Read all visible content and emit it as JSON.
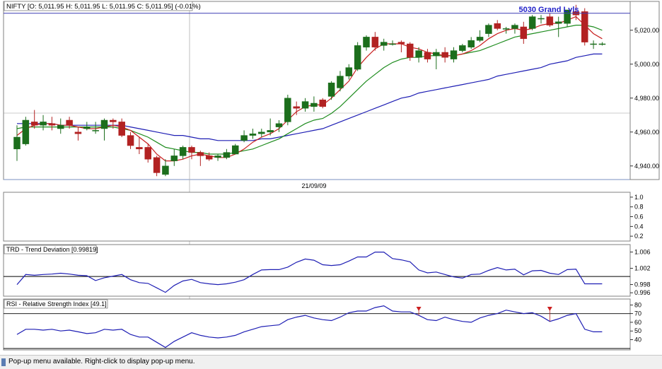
{
  "chart_data": [
    {
      "type": "candlestick",
      "header": "NIFTY [O: 5,011.95  H: 5,011.95  L: 5,011.95  C: 5,011.95] (-0.01%)",
      "annotation": "5030 Grand Lvls",
      "x_date_label": "21/09/09",
      "ylim": [
        4932,
        5037
      ],
      "y_ticks": [
        "5,020.00",
        "5,000.00",
        "4,980.00",
        "4,960.00",
        "4,940.00"
      ],
      "y_tick_values": [
        5020,
        5000,
        4980,
        4960,
        4940
      ],
      "hline": 5030,
      "candles": [
        {
          "o": 4950,
          "h": 4964,
          "l": 4943,
          "c": 4957
        },
        {
          "o": 4953,
          "h": 4969,
          "l": 4952,
          "c": 4967
        },
        {
          "o": 4966,
          "h": 4973,
          "l": 4962,
          "c": 4964
        },
        {
          "o": 4964,
          "h": 4970,
          "l": 4961,
          "c": 4966
        },
        {
          "o": 4965,
          "h": 4969,
          "l": 4961,
          "c": 4964
        },
        {
          "o": 4962,
          "h": 4968,
          "l": 4959,
          "c": 4964
        },
        {
          "o": 4967,
          "h": 4969,
          "l": 4962,
          "c": 4964
        },
        {
          "o": 4960,
          "h": 4963,
          "l": 4955,
          "c": 4959
        },
        {
          "o": 4962,
          "h": 4966,
          "l": 4961,
          "c": 4963
        },
        {
          "o": 4961,
          "h": 4966,
          "l": 4959,
          "c": 4961
        },
        {
          "o": 4962,
          "h": 4968,
          "l": 4955,
          "c": 4967
        },
        {
          "o": 4967,
          "h": 4968,
          "l": 4962,
          "c": 4966
        },
        {
          "o": 4966,
          "h": 4968,
          "l": 4957,
          "c": 4958
        },
        {
          "o": 4958,
          "h": 4960,
          "l": 4950,
          "c": 4952
        },
        {
          "o": 4951,
          "h": 4957,
          "l": 4947,
          "c": 4950
        },
        {
          "o": 4951,
          "h": 4953,
          "l": 4942,
          "c": 4944
        },
        {
          "o": 4945,
          "h": 4946,
          "l": 4934,
          "c": 4936
        },
        {
          "o": 4935,
          "h": 4944,
          "l": 4934,
          "c": 4940
        },
        {
          "o": 4943,
          "h": 4950,
          "l": 4940,
          "c": 4946
        },
        {
          "o": 4946,
          "h": 4952,
          "l": 4944,
          "c": 4951
        },
        {
          "o": 4951,
          "h": 4952,
          "l": 4944,
          "c": 4948
        },
        {
          "o": 4948,
          "h": 4949,
          "l": 4940,
          "c": 4946
        },
        {
          "o": 4946,
          "h": 4948,
          "l": 4943,
          "c": 4944
        },
        {
          "o": 4945,
          "h": 4947,
          "l": 4943,
          "c": 4946
        },
        {
          "o": 4945,
          "h": 4950,
          "l": 4944,
          "c": 4948
        },
        {
          "o": 4947,
          "h": 4953,
          "l": 4947,
          "c": 4952
        },
        {
          "o": 4955,
          "h": 4961,
          "l": 4954,
          "c": 4958
        },
        {
          "o": 4958,
          "h": 4962,
          "l": 4956,
          "c": 4959
        },
        {
          "o": 4959,
          "h": 4962,
          "l": 4957,
          "c": 4960
        },
        {
          "o": 4960,
          "h": 4968,
          "l": 4958,
          "c": 4961
        },
        {
          "o": 4963,
          "h": 4967,
          "l": 4960,
          "c": 4965
        },
        {
          "o": 4966,
          "h": 4982,
          "l": 4964,
          "c": 4980
        },
        {
          "o": 4975,
          "h": 4978,
          "l": 4970,
          "c": 4974
        },
        {
          "o": 4974,
          "h": 4980,
          "l": 4972,
          "c": 4978
        },
        {
          "o": 4975,
          "h": 4981,
          "l": 4972,
          "c": 4977
        },
        {
          "o": 4979,
          "h": 4980,
          "l": 4974,
          "c": 4975
        },
        {
          "o": 4981,
          "h": 4990,
          "l": 4979,
          "c": 4989
        },
        {
          "o": 4986,
          "h": 4996,
          "l": 4984,
          "c": 4993
        },
        {
          "o": 4993,
          "h": 5000,
          "l": 4991,
          "c": 4998
        },
        {
          "o": 4997,
          "h": 5013,
          "l": 4996,
          "c": 5011
        },
        {
          "o": 5010,
          "h": 5017,
          "l": 5008,
          "c": 5016
        },
        {
          "o": 5016,
          "h": 5019,
          "l": 5008,
          "c": 5010
        },
        {
          "o": 5011,
          "h": 5015,
          "l": 5008,
          "c": 5013
        },
        {
          "o": 5012,
          "h": 5014,
          "l": 5011,
          "c": 5012
        },
        {
          "o": 5013,
          "h": 5014,
          "l": 5007,
          "c": 5012
        },
        {
          "o": 5012,
          "h": 5013,
          "l": 5002,
          "c": 5004
        },
        {
          "o": 5004,
          "h": 5010,
          "l": 5001,
          "c": 5008
        },
        {
          "o": 5007,
          "h": 5009,
          "l": 5001,
          "c": 5003
        },
        {
          "o": 5005,
          "h": 5009,
          "l": 4997,
          "c": 5007
        },
        {
          "o": 5007,
          "h": 5010,
          "l": 5001,
          "c": 5004
        },
        {
          "o": 5003,
          "h": 5010,
          "l": 5001,
          "c": 5008
        },
        {
          "o": 5008,
          "h": 5012,
          "l": 5007,
          "c": 5011
        },
        {
          "o": 5010,
          "h": 5016,
          "l": 5009,
          "c": 5014
        },
        {
          "o": 5014,
          "h": 5020,
          "l": 5013,
          "c": 5016
        },
        {
          "o": 5018,
          "h": 5024,
          "l": 5016,
          "c": 5023
        },
        {
          "o": 5024,
          "h": 5026,
          "l": 5020,
          "c": 5021
        },
        {
          "o": 5021,
          "h": 5022,
          "l": 5018,
          "c": 5021
        },
        {
          "o": 5021,
          "h": 5024,
          "l": 5018,
          "c": 5023
        },
        {
          "o": 5022,
          "h": 5025,
          "l": 5012,
          "c": 5015
        },
        {
          "o": 5021,
          "h": 5029,
          "l": 5020,
          "c": 5028
        },
        {
          "o": 5027,
          "h": 5029,
          "l": 5024,
          "c": 5027
        },
        {
          "o": 5028,
          "h": 5030,
          "l": 5022,
          "c": 5023
        },
        {
          "o": 5024,
          "h": 5028,
          "l": 5016,
          "c": 5025
        },
        {
          "o": 5024,
          "h": 5032,
          "l": 5022,
          "c": 5032
        },
        {
          "o": 5031,
          "h": 5035,
          "l": 5026,
          "c": 5029
        },
        {
          "o": 5031,
          "h": 5033,
          "l": 5011,
          "c": 5013
        },
        {
          "o": 5012,
          "h": 5014,
          "l": 5009,
          "c": 5012
        },
        {
          "o": 5012,
          "h": 5013,
          "l": 5011,
          "c": 5012
        }
      ],
      "ma_short": [
        4958,
        4962,
        4964,
        4965,
        4965,
        4964,
        4964,
        4963,
        4962,
        4962,
        4963,
        4964,
        4963,
        4961,
        4957,
        4953,
        4947,
        4943,
        4943,
        4944,
        4946,
        4947,
        4946,
        4945,
        4945,
        4947,
        4950,
        4954,
        4957,
        4959,
        4962,
        4967,
        4972,
        4975,
        4976,
        4976,
        4980,
        4985,
        4990,
        4998,
        5004,
        5009,
        5012,
        5012,
        5012,
        5010,
        5009,
        5007,
        5006,
        5005,
        5005,
        5006,
        5008,
        5011,
        5015,
        5018,
        5020,
        5021,
        5020,
        5021,
        5023,
        5024,
        5024,
        5026,
        5028,
        5023,
        5018,
        5015
      ],
      "ma_mid": [
        4962,
        4963,
        4963,
        4963,
        4963,
        4963,
        4963,
        4963,
        4963,
        4963,
        4963,
        4963,
        4962,
        4961,
        4959,
        4957,
        4954,
        4951,
        4950,
        4949,
        4948,
        4948,
        4947,
        4947,
        4947,
        4948,
        4949,
        4950,
        4952,
        4954,
        4956,
        4959,
        4962,
        4965,
        4967,
        4968,
        4971,
        4975,
        4980,
        4985,
        4990,
        4994,
        4998,
        5001,
        5003,
        5004,
        5004,
        5005,
        5005,
        5005,
        5005,
        5006,
        5007,
        5008,
        5010,
        5012,
        5014,
        5016,
        5017,
        5018,
        5019,
        5020,
        5021,
        5022,
        5023,
        5023,
        5022,
        5020
      ],
      "ma_long": [
        4965,
        4965,
        4965,
        4965,
        4965,
        4964,
        4964,
        4964,
        4964,
        4964,
        4964,
        4964,
        4964,
        4963,
        4962,
        4961,
        4960,
        4959,
        4958,
        4958,
        4957,
        4956,
        4956,
        4955,
        4955,
        4955,
        4955,
        4955,
        4956,
        4956,
        4957,
        4958,
        4959,
        4960,
        4961,
        4962,
        4964,
        4966,
        4968,
        4970,
        4972,
        4974,
        4976,
        4978,
        4980,
        4981,
        4983,
        4984,
        4985,
        4986,
        4987,
        4988,
        4989,
        4990,
        4991,
        4993,
        4994,
        4995,
        4996,
        4997,
        4998,
        5000,
        5001,
        5002,
        5004,
        5005,
        5006,
        5006
      ]
    },
    {
      "type": "line",
      "ylim": [
        0.1,
        1.1
      ],
      "y_ticks": [
        "1.0",
        "0.8",
        "0.6",
        "0.4",
        "0.2"
      ],
      "y_tick_values": [
        1.0,
        0.8,
        0.6,
        0.4,
        0.2
      ]
    },
    {
      "type": "line",
      "title": "TRD - Trend Deviation [0.99819]",
      "ylim": [
        0.9955,
        1.0075
      ],
      "y_ticks": [
        "1.006",
        "1.002",
        "0.998",
        "0.996"
      ],
      "y_tick_values": [
        1.006,
        1.002,
        0.998,
        0.996
      ],
      "hline": 1.0,
      "values": [
        0.998,
        1.0005,
        1.0003,
        1.0005,
        1.0006,
        1.0008,
        1.0006,
        1.0003,
        1.0002,
        0.999,
        0.9997,
        1.0001,
        1.0005,
        0.9992,
        0.9985,
        0.9983,
        0.9972,
        0.9961,
        0.9978,
        0.9989,
        0.9993,
        0.9985,
        0.9982,
        0.998,
        0.9982,
        0.9986,
        0.9992,
        1.0005,
        1.0016,
        1.0017,
        1.0017,
        1.0023,
        1.0035,
        1.0043,
        1.004,
        1.0029,
        1.0027,
        1.0029,
        1.0038,
        1.0048,
        1.0048,
        1.006,
        1.006,
        1.0044,
        1.0041,
        1.0036,
        1.0016,
        1.0009,
        1.0011,
        1.0005,
        0.9999,
        0.9996,
        1.0005,
        1.0006,
        1.0015,
        1.0022,
        1.0016,
        1.0018,
        1.0004,
        1.0014,
        1.0015,
        1.0008,
        1.0005,
        1.0017,
        1.0018,
        0.9982,
        0.9982,
        0.9982
      ]
    },
    {
      "type": "line",
      "title": "RSI - Relative Strength Index [49.1]",
      "ylim": [
        29,
        86
      ],
      "y_ticks": [
        "80",
        "70",
        "60",
        "50",
        "40"
      ],
      "y_tick_values": [
        80,
        70,
        60,
        50,
        40
      ],
      "hline": 70,
      "markers_at": [
        46,
        61
      ],
      "values": [
        46,
        52,
        52,
        51,
        52,
        50,
        51,
        49,
        47,
        48,
        52,
        51,
        52,
        46,
        43,
        43,
        37,
        31,
        38,
        43,
        48,
        45,
        43,
        42,
        43,
        45,
        49,
        52,
        55,
        56,
        57,
        63,
        66,
        68,
        65,
        63,
        62,
        66,
        71,
        73,
        73,
        77,
        79,
        73,
        72,
        72,
        68,
        63,
        62,
        66,
        63,
        61,
        60,
        65,
        68,
        70,
        74,
        72,
        70,
        71,
        67,
        61,
        64,
        68,
        70,
        52,
        49,
        49
      ]
    }
  ],
  "status_bar": {
    "text": "Pop-up menu available. Right-click to display pop-up menu."
  }
}
